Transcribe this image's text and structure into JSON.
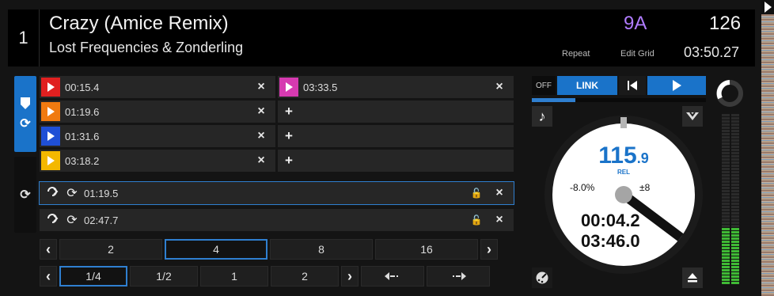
{
  "deck": {
    "number": "1",
    "title": "Crazy (Amice Remix)",
    "artist": "Lost Frequencies & Zonderling",
    "key": "9A",
    "bpm": "126",
    "repeat_label": "Repeat",
    "edit_grid_label": "Edit Grid",
    "duration": "03:50.27"
  },
  "hotcues": [
    {
      "time": "00:15.4",
      "color": "#e02020"
    },
    {
      "time": "01:19.6",
      "color": "#f07a10"
    },
    {
      "time": "01:31.6",
      "color": "#1f4fd6"
    },
    {
      "time": "03:18.2",
      "color": "#f4b800"
    }
  ],
  "hotcues_right": [
    {
      "time": "03:33.5",
      "color": "#d63ab0"
    }
  ],
  "saved_loops": [
    {
      "time": "01:19.5",
      "selected": true
    },
    {
      "time": "02:47.7",
      "selected": false
    }
  ],
  "icons": {
    "close": "×",
    "add": "+",
    "loop": "⟳",
    "lock": "🔓"
  },
  "loop_sizes": [
    "2",
    "4",
    "8",
    "16"
  ],
  "loop_sizes_active": "4",
  "beat_jumps": [
    "1/4",
    "1/2",
    "1",
    "2"
  ],
  "beat_jumps_active": "1/4",
  "transport": {
    "off_label": "OFF",
    "link_label": "LINK",
    "progress_fraction": 0.25
  },
  "jog": {
    "bpm_int": "115",
    "bpm_dec": ".9",
    "rel_label": "REL",
    "pitch": "-8.0%",
    "pitch_range": "±8",
    "elapsed": "00:04.2",
    "remaining": "03:46.0"
  },
  "colors": {
    "accent": "#1a73c9",
    "key": "#b07cff"
  }
}
